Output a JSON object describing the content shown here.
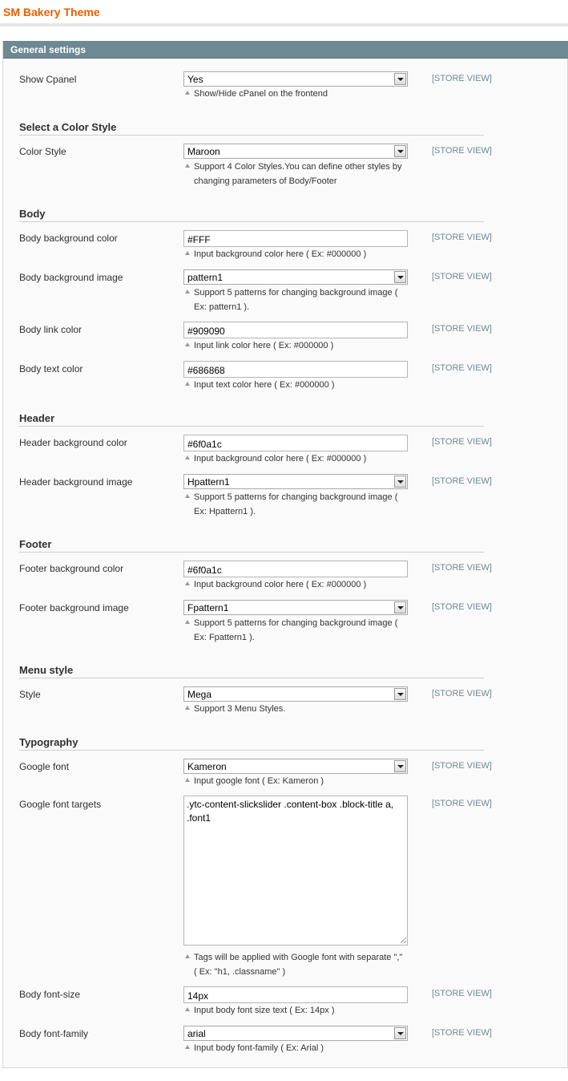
{
  "page": {
    "title": "SM Bakery Theme"
  },
  "panel": {
    "title": "General settings"
  },
  "scope_label": "[STORE VIEW]",
  "colors": {
    "title": "#eb5e00",
    "panel_header": "#6f8992",
    "scope": "#6f8992"
  },
  "icons": {
    "select_arrow": "chevron-down-icon",
    "note_marker": "triangle-up-icon",
    "resize": "resize-grip-icon"
  },
  "sections": {
    "color_style": "Select a Color Style",
    "body": "Body",
    "header": "Header",
    "footer": "Footer",
    "menu": "Menu style",
    "typography": "Typography"
  },
  "fields": {
    "show_cpanel": {
      "label": "Show Cpanel",
      "value": "Yes",
      "note": "Show/Hide cPanel on the frontend"
    },
    "color_style": {
      "label": "Color Style",
      "value": "Maroon",
      "note_lines": [
        "Support 4 Color Styles.You can define other styles by",
        "changing parameters of Body/Footer"
      ]
    },
    "body_bg_color": {
      "label": "Body background color",
      "value": "#FFF",
      "note": "Input background color here ( Ex: #000000 )"
    },
    "body_bg_image": {
      "label": "Body background image",
      "value": "pattern1",
      "note_lines": [
        "Support 5 patterns for changing background image (",
        "Ex: pattern1 )."
      ]
    },
    "body_link_color": {
      "label": "Body link color",
      "value": "#909090",
      "note": "Input link color here ( Ex: #000000 )"
    },
    "body_text_color": {
      "label": "Body text color",
      "value": "#686868",
      "note": "Input text color here ( Ex: #000000 )"
    },
    "header_bg_color": {
      "label": "Header background color",
      "value": "#6f0a1c",
      "note": "Input background color here ( Ex: #000000 )"
    },
    "header_bg_image": {
      "label": "Header background image",
      "value": "Hpattern1",
      "note_lines": [
        "Support 5 patterns for changing background image (",
        "Ex: Hpattern1 )."
      ]
    },
    "footer_bg_color": {
      "label": "Footer background color",
      "value": "#6f0a1c",
      "note": "Input background color here ( Ex: #000000 )"
    },
    "footer_bg_image": {
      "label": "Footer background image",
      "value": "Fpattern1",
      "note_lines": [
        "Support 5 patterns for changing background image (",
        "Ex: Fpattern1 )."
      ]
    },
    "menu_style": {
      "label": "Style",
      "value": "Mega",
      "note": "Support 3 Menu Styles."
    },
    "google_font": {
      "label": "Google font",
      "value": "Kameron",
      "note": "Input google font ( Ex: Kameron )"
    },
    "google_font_targets": {
      "label": "Google font targets",
      "value": ".ytc-content-slickslider .content-box .block-title a,\n.font1",
      "note_lines": [
        "Tags will be applied with Google font with separate \",\"",
        "( Ex: \"h1, .classname\" )"
      ]
    },
    "body_font_size": {
      "label": "Body font-size",
      "value": "14px",
      "note": "Input body font size text ( Ex: 14px )"
    },
    "body_font_family": {
      "label": "Body font-family",
      "value": "arial",
      "note": "Input body font-family ( Ex: Arial )"
    }
  }
}
